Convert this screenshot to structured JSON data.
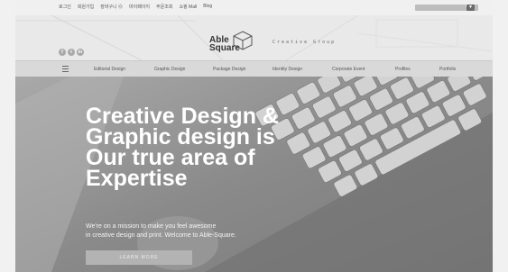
{
  "topbar": {
    "links": [
      "로그인",
      "회원가입",
      "장바구니 ⓪",
      "마이페이지",
      "주문조회",
      "쇼핑 Mall",
      "Blog"
    ],
    "search_icon": "search-icon",
    "lang_icon": "lang-icon"
  },
  "header": {
    "logo_line1": "Able",
    "logo_line2": "Square",
    "logo_subtitle": "Creative Group",
    "social": [
      "f",
      "t",
      "in"
    ]
  },
  "nav": {
    "menu_icon": "hamburger-menu-icon",
    "items": [
      "Editorial Design",
      "Graphic Design",
      "Package Design",
      "Identity Design",
      "Corporate Event",
      "Profiles",
      "Portfolio"
    ]
  },
  "hero": {
    "title_lines": [
      "Creative Design &",
      "Graphic design is",
      "Our true area of",
      "Expertise"
    ],
    "desc_lines": [
      "We're on a mission to make you feel awesome",
      "in creative design and print. Welcome to Able-Square."
    ],
    "button_label": "LEARN MORE"
  },
  "colors": {
    "hero_bg": "#8c8c8c",
    "nav_bg": "#d9d9d9",
    "title": "#ffffff"
  }
}
